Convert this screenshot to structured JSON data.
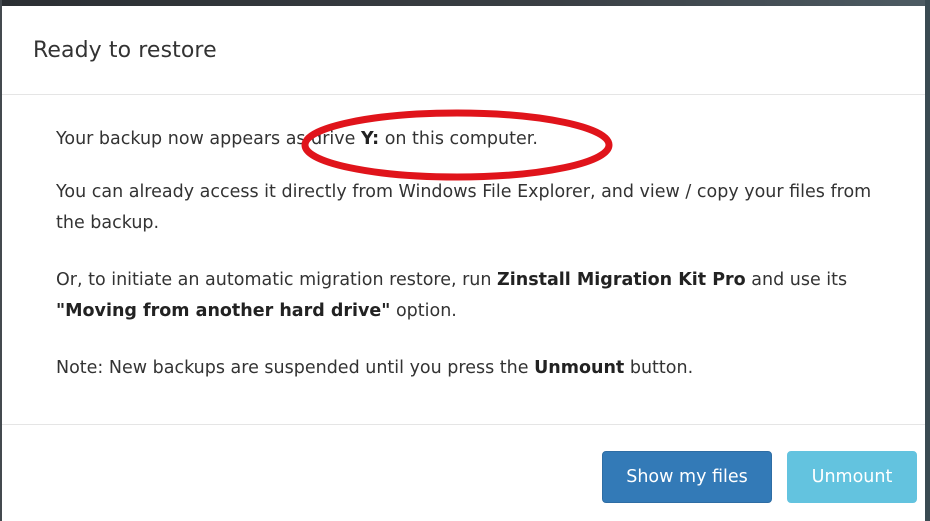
{
  "dialog": {
    "title": "Ready to restore"
  },
  "body": {
    "line1": {
      "pre": "Your backup now appears as drive ",
      "drive": "Y:",
      "post": " on this computer."
    },
    "line2": "You can already access it directly from Windows File Explorer, and view / copy your files from the backup.",
    "line3": {
      "pre": "Or, to initiate an automatic migration restore, run ",
      "product": "Zinstall Migration Kit Pro",
      "mid": " and use its ",
      "option": "\"Moving from another hard drive\"",
      "post": " option."
    },
    "line4": {
      "pre": "Note: New backups are suspended until you press the ",
      "button_ref": "Unmount",
      "post": " button."
    }
  },
  "footer": {
    "show_files_label": "Show my files",
    "unmount_label": "Unmount"
  },
  "colors": {
    "primary": "#337ab7",
    "info": "#5bc0de",
    "annotation": "#e0141b"
  }
}
